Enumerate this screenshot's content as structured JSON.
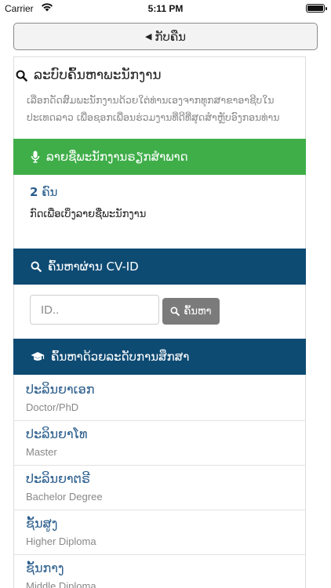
{
  "status_bar": {
    "carrier": "Carrier",
    "time": "5:11 PM"
  },
  "nav": {
    "back_label": "ກັບຄືນ"
  },
  "search": {
    "title": "ລະບົບຄົ້ນຫາພະນັກງານ",
    "description": "ເລືອກດັດສົມພະນັກງານດ້ວຍໃຕ່ທ່ານເອງຈາກທຸກສາຂາອາຊີບໃນ ປະເທດລາວ ເພື່ອຊອກເພື່ອນຮ່ວມງານທີ່ດີທີ່ສຸດສຳຫຼັບອົງກອນທ່ານ"
  },
  "interview_section": {
    "header": "ລາຍຊື່ພະນັກງານຣຽກສຳພາດ",
    "count_number": "2",
    "count_unit": "ຄົນ",
    "view_label": "ກົດເພື່ອເບິ່ງລາຍຊື່ພະນັກງານ"
  },
  "cv_section": {
    "header": "ຄົ້ນຫາຜ່ານ CV-ID",
    "input_placeholder": "ID..",
    "button_label": "ຄົ້ນຫາ"
  },
  "education_section": {
    "header": "ຄົ້ນຫາດ້ວຍລະດັບການສຶກສາ",
    "items": [
      {
        "lao": "ປະລິນຍາເອກ",
        "en": "Doctor/PhD"
      },
      {
        "lao": "ປະລິນຍາໂທ",
        "en": "Master"
      },
      {
        "lao": "ປະລິນຍາຕຣີ",
        "en": "Bachelor Degree"
      },
      {
        "lao": "ຊັ້ນສູງ",
        "en": "Higher Diploma"
      },
      {
        "lao": "ຊັ້ນກາງ",
        "en": "Middle Diploma"
      }
    ]
  },
  "colors": {
    "green": "#3fae49",
    "navy": "#0e4b73",
    "link_blue": "#2a5d8c",
    "button_gray": "#7b7b7b"
  }
}
